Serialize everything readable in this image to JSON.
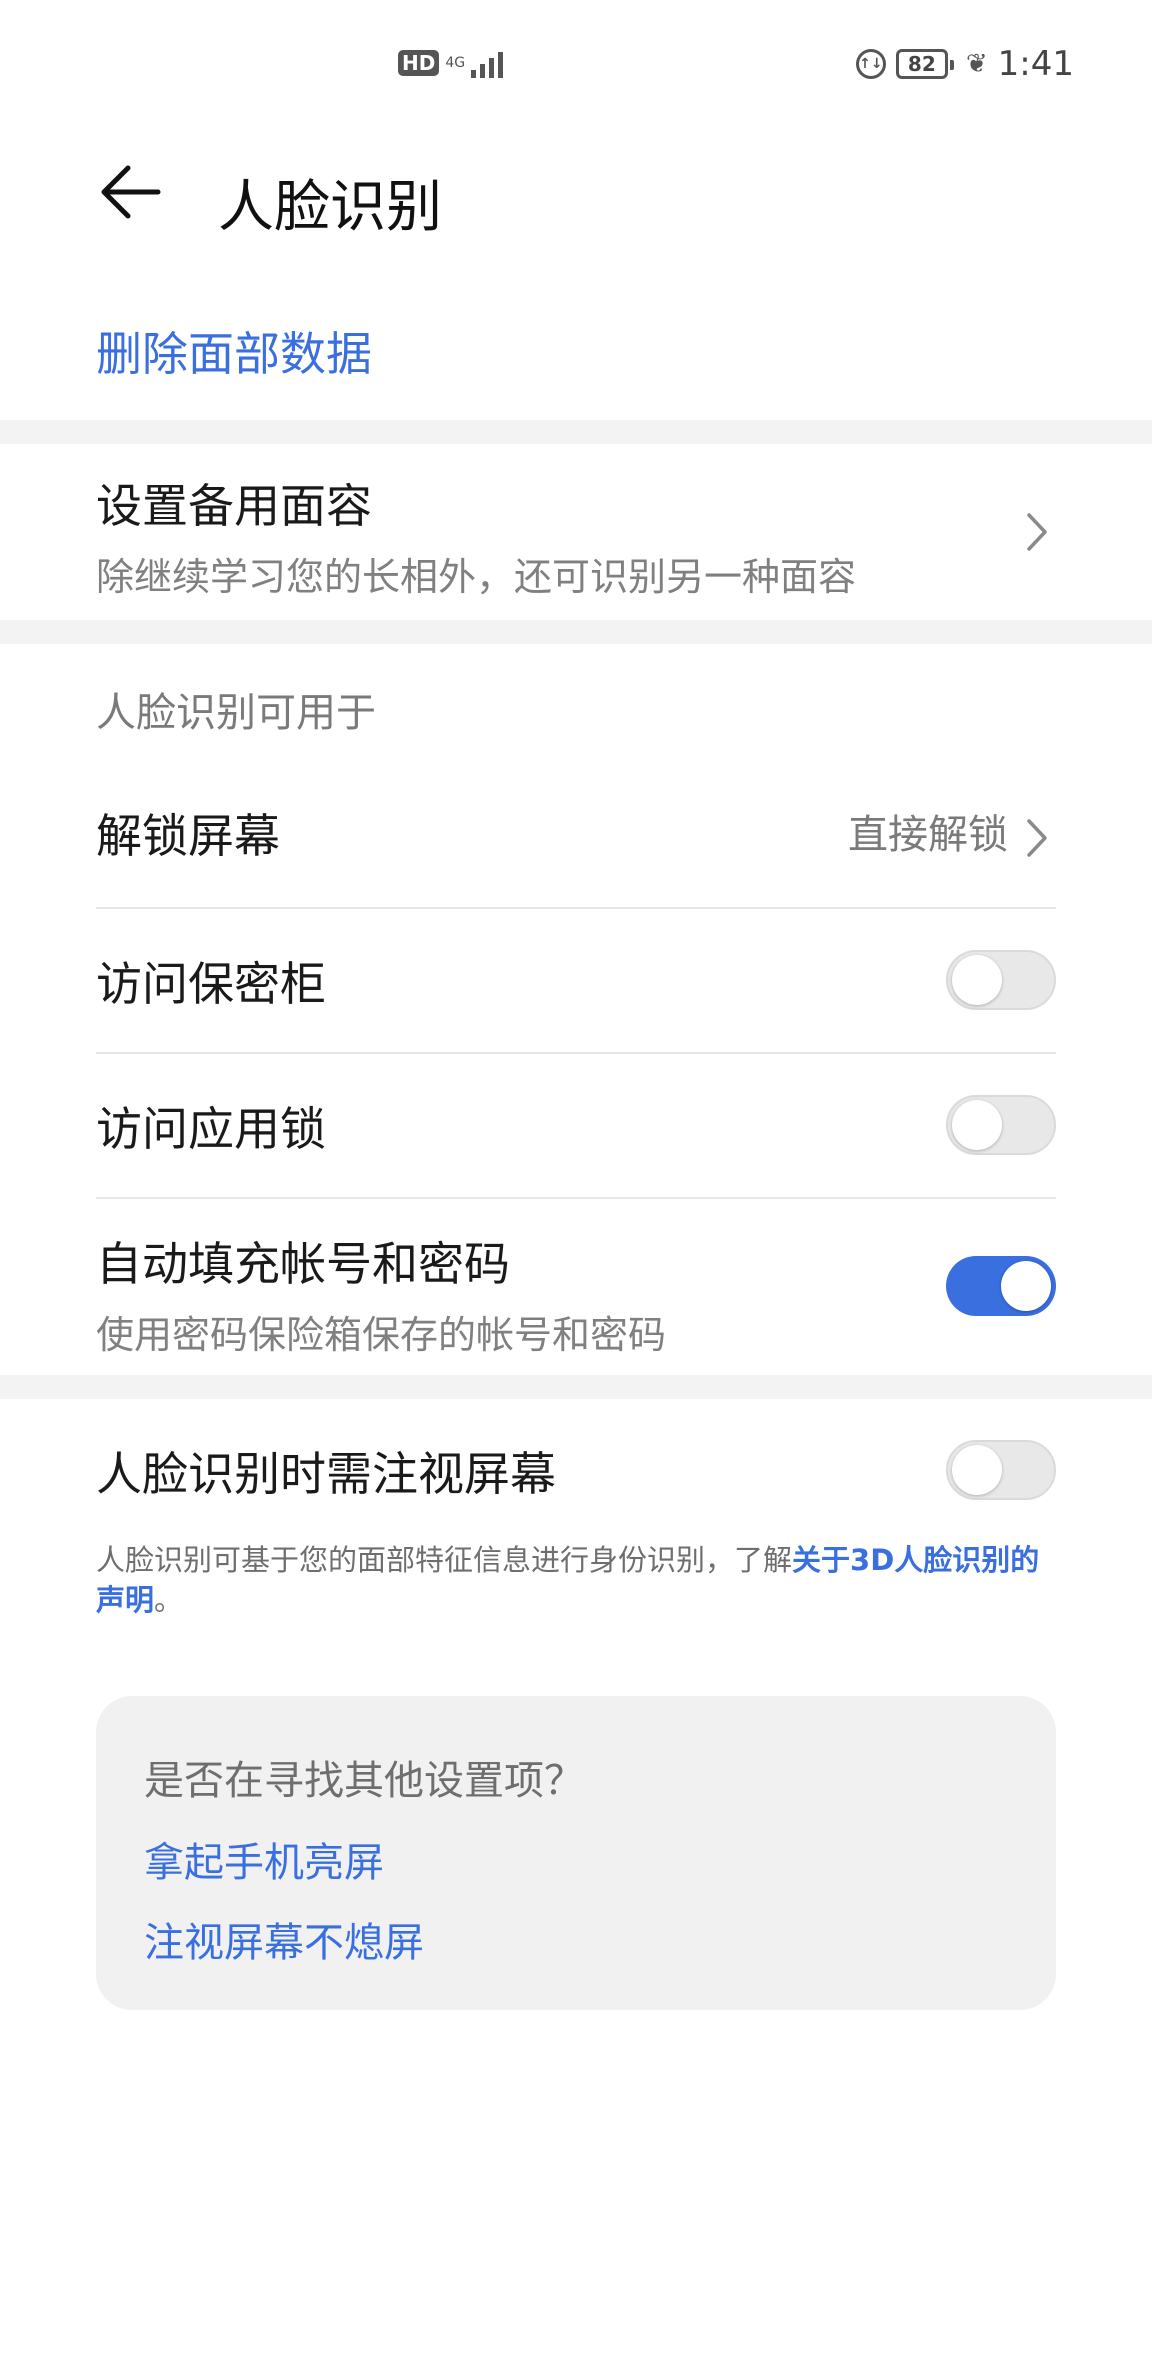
{
  "status_bar": {
    "hd": "HD",
    "network": "4G",
    "battery_level": "82",
    "time": "1:41"
  },
  "header": {
    "title": "人脸识别",
    "back_icon": "arrow-left-icon"
  },
  "delete_face_data": "删除面部数据",
  "alternate_face": {
    "title": "设置备用面容",
    "subtitle": "除继续学习您的长相外，还可识别另一种面容"
  },
  "usage_section": {
    "caption": "人脸识别可用于",
    "unlock": {
      "title": "解锁屏幕",
      "value": "直接解锁"
    },
    "safe": {
      "title": "访问保密柜",
      "enabled": false
    },
    "app_lock": {
      "title": "访问应用锁",
      "enabled": false
    },
    "autofill": {
      "title": "自动填充帐号和密码",
      "subtitle": "使用密码保险箱保存的帐号和密码",
      "enabled": true
    }
  },
  "require_gaze": {
    "title": "人脸识别时需注视屏幕",
    "enabled": false
  },
  "footnote": {
    "text": "人脸识别可基于您的面部特征信息进行身份识别，了解",
    "link": "关于3D人脸识别的声明",
    "end": "。"
  },
  "other_settings": {
    "title": "是否在寻找其他设置项？",
    "links": [
      "拿起手机亮屏",
      "注视屏幕不熄屏"
    ]
  },
  "colors": {
    "accent": "#3a6fe0",
    "band": "#f3f3f3",
    "card": "#f1f1f1"
  }
}
